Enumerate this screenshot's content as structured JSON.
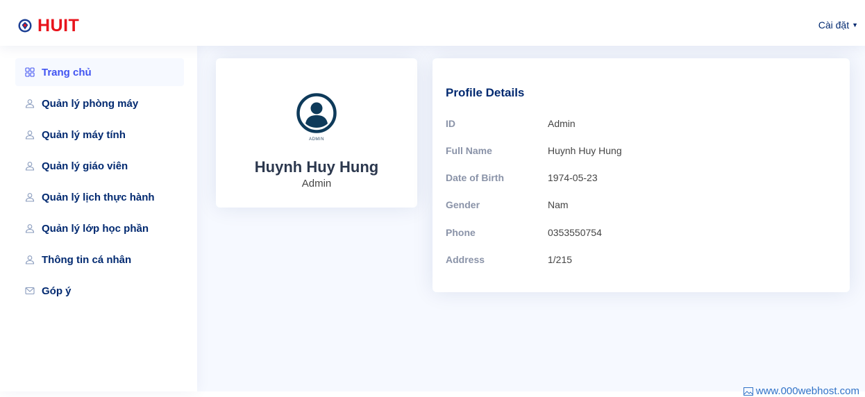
{
  "header": {
    "logo_text": "HUIT",
    "settings_label": "Cài đặt"
  },
  "sidebar": {
    "items": [
      {
        "label": "Trang chủ",
        "icon": "grid-icon",
        "active": true
      },
      {
        "label": "Quản lý phòng máy",
        "icon": "person-icon"
      },
      {
        "label": "Quản lý máy tính",
        "icon": "person-icon"
      },
      {
        "label": "Quản lý giáo viên",
        "icon": "person-icon"
      },
      {
        "label": "Quản lý lịch thực hành",
        "icon": "person-icon"
      },
      {
        "label": "Quản lý lớp học phần",
        "icon": "person-icon"
      },
      {
        "label": "Thông tin cá nhân",
        "icon": "person-icon"
      },
      {
        "label": "Góp ý",
        "icon": "envelope-icon"
      }
    ]
  },
  "profile_card": {
    "avatar_caption": "ADMIN",
    "name": "Huynh Huy Hung",
    "role": "Admin"
  },
  "details": {
    "title": "Profile Details",
    "rows": [
      {
        "label": "ID",
        "value": "Admin"
      },
      {
        "label": "Full Name",
        "value": "Huynh Huy Hung"
      },
      {
        "label": "Date of Birth",
        "value": "1974-05-23"
      },
      {
        "label": "Gender",
        "value": "Nam"
      },
      {
        "label": "Phone",
        "value": "0353550754"
      },
      {
        "label": "Address",
        "value": "1/215"
      }
    ]
  },
  "watermark": {
    "text": "www.000webhost.com"
  },
  "colors": {
    "brand_red": "#e8141c",
    "navy": "#012970",
    "accent_blue": "#4154f1",
    "page_bg": "#f6f9ff"
  }
}
